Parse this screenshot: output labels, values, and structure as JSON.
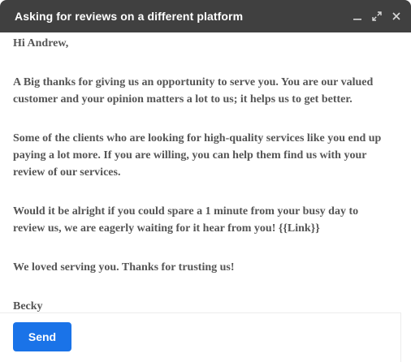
{
  "window": {
    "title": "Asking for reviews on a different platform",
    "controls": [
      {
        "name": "minimize-icon",
        "label": "Minimize"
      },
      {
        "name": "expand-icon",
        "label": "Full screen"
      },
      {
        "name": "close-icon",
        "label": "Save & close"
      }
    ]
  },
  "email": {
    "greeting": "Hi Andrew,",
    "p1_l1": "A Big thanks for giving us an opportunity to serve you. You are our valued",
    "p1_l2": "customer and your opinion matters a lot to us; it helps us to get better.",
    "p2_l1": "Some of the clients who are looking for high-quality services like you end up",
    "p2_l2": "paying a lot more. If you are willing, you can help them find us with your",
    "p2_l3": "review of our services.",
    "p3_l1": "Would it be alright if you could spare a 1 minute from your busy day to",
    "p3_l2": "review us, we are eagerly waiting for it hear from you! {{Link}}",
    "p4": "We loved serving you. Thanks for trusting us!",
    "signature": "Becky"
  },
  "footer": {
    "send_label": "Send"
  },
  "colors": {
    "titlebar": "#404040",
    "body_text": "#555555",
    "send_button": "#1a73e8"
  }
}
